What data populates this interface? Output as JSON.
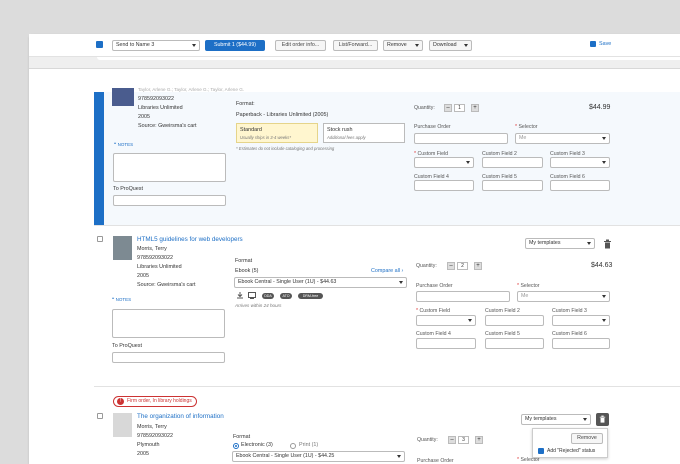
{
  "toolbar": {
    "send_to": "Send to Name 3",
    "submit": "Submit 1 ($44.99)",
    "edit_order": "Edit order info...",
    "list_forward": "List/Forward...",
    "remove": "Remove",
    "download": "Download",
    "save": "Save"
  },
  "item1": {
    "cut_title": "Taylor, Arlene G.; Taylor, Arlene G.; Taylor, Arlene G.",
    "isbn": "978592093022",
    "publisher": "Libraries Unlimited",
    "year": "2005",
    "source": "Source: Gweirsma's cart",
    "notes_label": "NOTES",
    "to_proquest": "To ProQuest",
    "format_label": "Format:",
    "format_value": "Paperback - Libraries Unlimited (2005)",
    "opt1_title": "Standard",
    "opt1_sub": "Usually ships in 3-4 weeks*",
    "opt2_title": "Stock rush",
    "opt2_sub": "Additional fees apply",
    "estimate_note": "* Estimates do not include cataloging and processing",
    "quantity_label": "Quantity:",
    "qty_minus": "–",
    "qty": "1",
    "qty_plus": "+",
    "price": "$44.99",
    "purchase_order": "Purchase Order",
    "selector": "Selector",
    "selector_value": "Me",
    "cf3": "Custom Field 3",
    "cf2": "Custom Field 2",
    "cf1": "Custom Field",
    "cf4": "Custom Field 4",
    "cf5": "Custom Field 5",
    "cf6": "Custom Field 6"
  },
  "item2": {
    "title": "HTML5 guidelines for web developers",
    "author": "Morris, Terry",
    "isbn": "978592093022",
    "publisher": "Libraries Unlimited",
    "year": "2005",
    "source": "Source: Gweirsma's cart",
    "notes_label": "NOTES",
    "to_proquest": "To ProQuest",
    "templates": "My templates",
    "format_label": "Format",
    "format_type": "Ebook (5)",
    "compare_all": "Compare all",
    "format_select": "Ebook Central - Single User (1U) - $44.63",
    "badges": [
      "DDA",
      "ATO",
      "DRM-free"
    ],
    "arrives": "Arrives within 24 hours",
    "quantity_label": "Quantity:",
    "qty_minus": "–",
    "qty": "2",
    "qty_plus": "+",
    "price": "$44.63",
    "purchase_order": "Purchase Order",
    "selector": "Selector",
    "selector_value": "Me",
    "cf1": "Custom Field",
    "cf2": "Custom Field 2",
    "cf3": "Custom Field 3",
    "cf4": "Custom Field 4",
    "cf5": "Custom Field 5",
    "cf6": "Custom Field 6"
  },
  "item3": {
    "firm_badge": "Firm order, In library holdings",
    "title": "The organization of information",
    "author": "Morris, Terry",
    "isbn": "978592093022",
    "publisher": "Plymouth",
    "year": "2005",
    "templates": "My templates",
    "format_label": "Format",
    "radio1": "Electronic (3)",
    "radio2": "Print (1)",
    "format_select": "Ebook Central - Single User (1U) - $44.25",
    "quantity_label": "Quantity:",
    "qty_minus": "–",
    "qty": "3",
    "qty_plus": "+",
    "purchase_order": "Purchase Order",
    "selector": "Selector",
    "popover_remove": "Remove",
    "popover_check": "Add \"Rejected\" status"
  }
}
